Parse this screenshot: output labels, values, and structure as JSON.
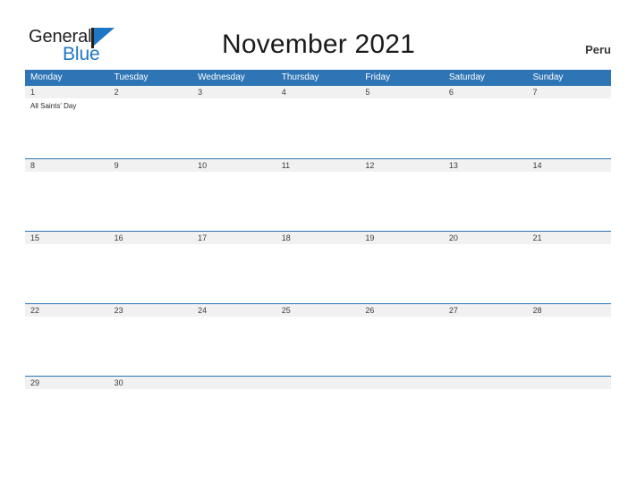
{
  "brand": {
    "name_part1": "General",
    "name_part2": "Blue",
    "flag_icon": "flag-icon",
    "colors": {
      "dark": "#231f20",
      "blue": "#1f76c4"
    }
  },
  "header": {
    "title": "November 2021",
    "country": "Peru"
  },
  "calendar": {
    "accent_color": "#2e75b6",
    "band_color": "#f1f1f1",
    "weekdays": [
      "Monday",
      "Tuesday",
      "Wednesday",
      "Thursday",
      "Friday",
      "Saturday",
      "Sunday"
    ],
    "weeks": [
      {
        "days": [
          {
            "number": "1",
            "events": [
              "All Saints' Day"
            ]
          },
          {
            "number": "2",
            "events": []
          },
          {
            "number": "3",
            "events": []
          },
          {
            "number": "4",
            "events": []
          },
          {
            "number": "5",
            "events": []
          },
          {
            "number": "6",
            "events": []
          },
          {
            "number": "7",
            "events": []
          }
        ]
      },
      {
        "days": [
          {
            "number": "8",
            "events": []
          },
          {
            "number": "9",
            "events": []
          },
          {
            "number": "10",
            "events": []
          },
          {
            "number": "11",
            "events": []
          },
          {
            "number": "12",
            "events": []
          },
          {
            "number": "13",
            "events": []
          },
          {
            "number": "14",
            "events": []
          }
        ]
      },
      {
        "days": [
          {
            "number": "15",
            "events": []
          },
          {
            "number": "16",
            "events": []
          },
          {
            "number": "17",
            "events": []
          },
          {
            "number": "18",
            "events": []
          },
          {
            "number": "19",
            "events": []
          },
          {
            "number": "20",
            "events": []
          },
          {
            "number": "21",
            "events": []
          }
        ]
      },
      {
        "days": [
          {
            "number": "22",
            "events": []
          },
          {
            "number": "23",
            "events": []
          },
          {
            "number": "24",
            "events": []
          },
          {
            "number": "25",
            "events": []
          },
          {
            "number": "26",
            "events": []
          },
          {
            "number": "27",
            "events": []
          },
          {
            "number": "28",
            "events": []
          }
        ]
      },
      {
        "days": [
          {
            "number": "29",
            "events": []
          },
          {
            "number": "30",
            "events": []
          },
          {
            "number": "",
            "events": []
          },
          {
            "number": "",
            "events": []
          },
          {
            "number": "",
            "events": []
          },
          {
            "number": "",
            "events": []
          },
          {
            "number": "",
            "events": []
          }
        ]
      }
    ]
  }
}
